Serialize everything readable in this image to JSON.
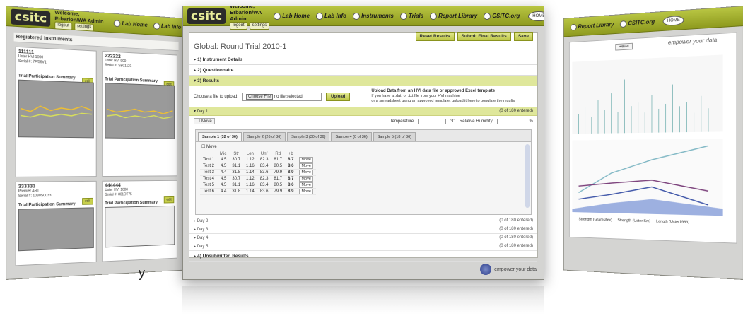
{
  "brand": {
    "logo": "csitc",
    "welcome": "Welcome, Erbarion/WA Admin",
    "logout": "logout",
    "settings": "settings"
  },
  "nav": {
    "lab_home": "Lab Home",
    "lab_info": "Lab Info",
    "instruments": "Instruments",
    "trials": "Trials",
    "report_library": "Report Library",
    "csitc_org": "CSITC.org",
    "home": "HOME"
  },
  "actions": {
    "reset": "Reset Results",
    "submit": "Submit Final Results",
    "save": "Save"
  },
  "page": {
    "title": "Global: Round Trial 2010-1",
    "section1": "1) Instrument Details",
    "section2": "2) Questionnaire",
    "section3": "3) Results",
    "section4": "4) Unsubmitted Results"
  },
  "upload": {
    "label": "Choose a file to upload:",
    "choose_file": "Choose File",
    "no_file": "no file selected",
    "button": "Upload",
    "info_title": "Upload Data from an HVI data file or approved Excel template",
    "info_line1": "If you have a .dat, or .txt file from your HVI machine",
    "info_line2": "or a spreadsheet using an approved template, upload it here to populate the results"
  },
  "day1": {
    "label": "Day 1",
    "status": "0 of 180 entered",
    "move": "Move",
    "temperature": "Temperature",
    "temp_unit": "°C",
    "humidity": "Relative Humidity",
    "humidity_unit": "%"
  },
  "tabs": [
    {
      "label": "Sample 1 (32 of 36)"
    },
    {
      "label": "Sample 2 (26 of 36)"
    },
    {
      "label": "Sample 3 (30 of 36)"
    },
    {
      "label": "Sample 4 (0 of 36)"
    },
    {
      "label": "Sample 5 (18 of 36)"
    }
  ],
  "grid": {
    "move": "Move",
    "headers": [
      "",
      "Mic",
      "Str",
      "Len",
      "Unf",
      "Rd",
      "+b",
      ""
    ],
    "rows": [
      {
        "label": "Test 1",
        "mic": "4.5",
        "str": "30.7",
        "len": "1.12",
        "unf": "82.3",
        "rd": "81.7",
        "b": "8.7",
        "move": "Move"
      },
      {
        "label": "Test 2",
        "mic": "4.5",
        "str": "31.1",
        "len": "1.16",
        "unf": "83.4",
        "rd": "80.5",
        "b": "8.6",
        "move": "Move"
      },
      {
        "label": "Test 3",
        "mic": "4.4",
        "str": "31.8",
        "len": "1.14",
        "unf": "83.6",
        "rd": "79.9",
        "b": "8.9",
        "move": "Move"
      },
      {
        "label": "Test 4",
        "mic": "4.5",
        "str": "30.7",
        "len": "1.12",
        "unf": "82.3",
        "rd": "81.7",
        "b": "8.7",
        "move": "Move"
      },
      {
        "label": "Test 5",
        "mic": "4.5",
        "str": "31.1",
        "len": "1.16",
        "unf": "83.4",
        "rd": "80.5",
        "b": "8.6",
        "move": "Move"
      },
      {
        "label": "Test 6",
        "mic": "4.4",
        "str": "31.8",
        "len": "1.14",
        "unf": "83.6",
        "rd": "79.9",
        "b": "8.9",
        "move": "Move"
      }
    ]
  },
  "days": [
    {
      "label": "Day 2",
      "status": "0 of 180 entered"
    },
    {
      "label": "Day 3",
      "status": "0 of 180 entered"
    },
    {
      "label": "Day 4",
      "status": "0 of 180 entered"
    },
    {
      "label": "Day 5",
      "status": "0 of 180 entered"
    }
  ],
  "footer": {
    "empower": "empower your data"
  },
  "left": {
    "registered": "Registered Instruments",
    "cards": [
      {
        "serial": "111111",
        "meta1": "Uster HVI 1000",
        "meta2": "Serial #: 7F/56V1",
        "edit": "edit",
        "summary": "Trial Participation Summary"
      },
      {
        "serial": "222222",
        "meta1": "Uster HVI 900",
        "meta2": "Serial #: SB01121",
        "edit": "edit",
        "summary": "Trial Participation Summary"
      },
      {
        "serial": "333333",
        "meta1": "Premier ART",
        "meta2": "Serial #: 1030S0033",
        "edit": "edit",
        "summary": "Trial Participation Summary"
      },
      {
        "serial": "444444",
        "meta1": "Uster HVI 1000",
        "meta2": "Serial #: 801DT75",
        "edit": "edit",
        "summary": "Trial Participation Summary"
      }
    ]
  },
  "right": {
    "reset": "Reset",
    "empower": "empower your data",
    "legend": [
      "Strength (Grams/tex)",
      "Strength (Uster Sm)",
      "Length (Uster1983)"
    ]
  },
  "fragment": "y",
  "colors": {
    "accent": "#b8c542",
    "highlight": "#dfe79b",
    "chrome": "#d4d4d2"
  }
}
